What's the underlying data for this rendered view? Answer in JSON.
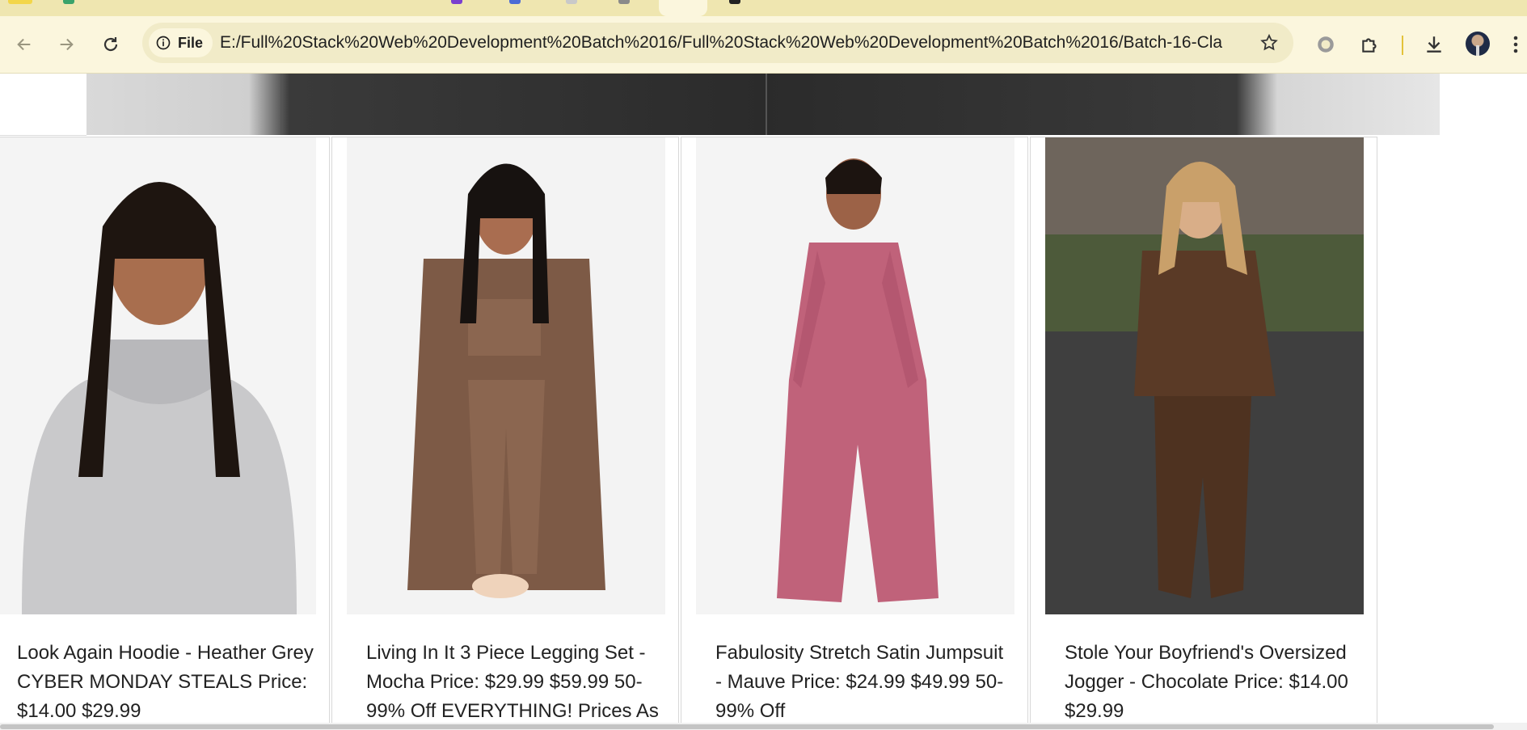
{
  "browser": {
    "url_chip_label": "File",
    "url": "E:/Full%20Stack%20Web%20Development%20Batch%2016/Full%20Stack%20Web%20Development%20Batch%2016/Batch-16-Class-1...",
    "colors": {
      "chrome": "#fbf6dd",
      "tabstrip": "#efe6b0",
      "omnibox": "#f1ebc8",
      "accent": "#e3c23a"
    },
    "icons": [
      "back-icon",
      "forward-icon",
      "reload-icon",
      "info-icon",
      "star-icon",
      "extension-circle-icon",
      "puzzle-icon",
      "download-icon",
      "avatar",
      "menu-icon"
    ]
  },
  "products": [
    {
      "title": "Look Again Hoodie - Heather Grey CYBER MONDAY STEALS Price: $14.00 $29.99",
      "image_alt": "Model in heather grey hoodie and sweatpants"
    },
    {
      "title": "Living In It 3 Piece Legging Set - Mocha Price: $29.99 $59.99 50-99% Off EVERYTHING! Prices As",
      "image_alt": "Model in mocha knit cardigan, bralette and leggings"
    },
    {
      "title": "Fabulosity Stretch Satin Jumpsuit - Mauve Price: $24.99 $49.99 50-99% Off",
      "image_alt": "Model in mauve satin jumpsuit"
    },
    {
      "title": "Stole Your Boyfriend's Oversized Jogger - Chocolate Price: $14.00 $29.99",
      "image_alt": "Model in chocolate hoodie and joggers on street"
    }
  ]
}
